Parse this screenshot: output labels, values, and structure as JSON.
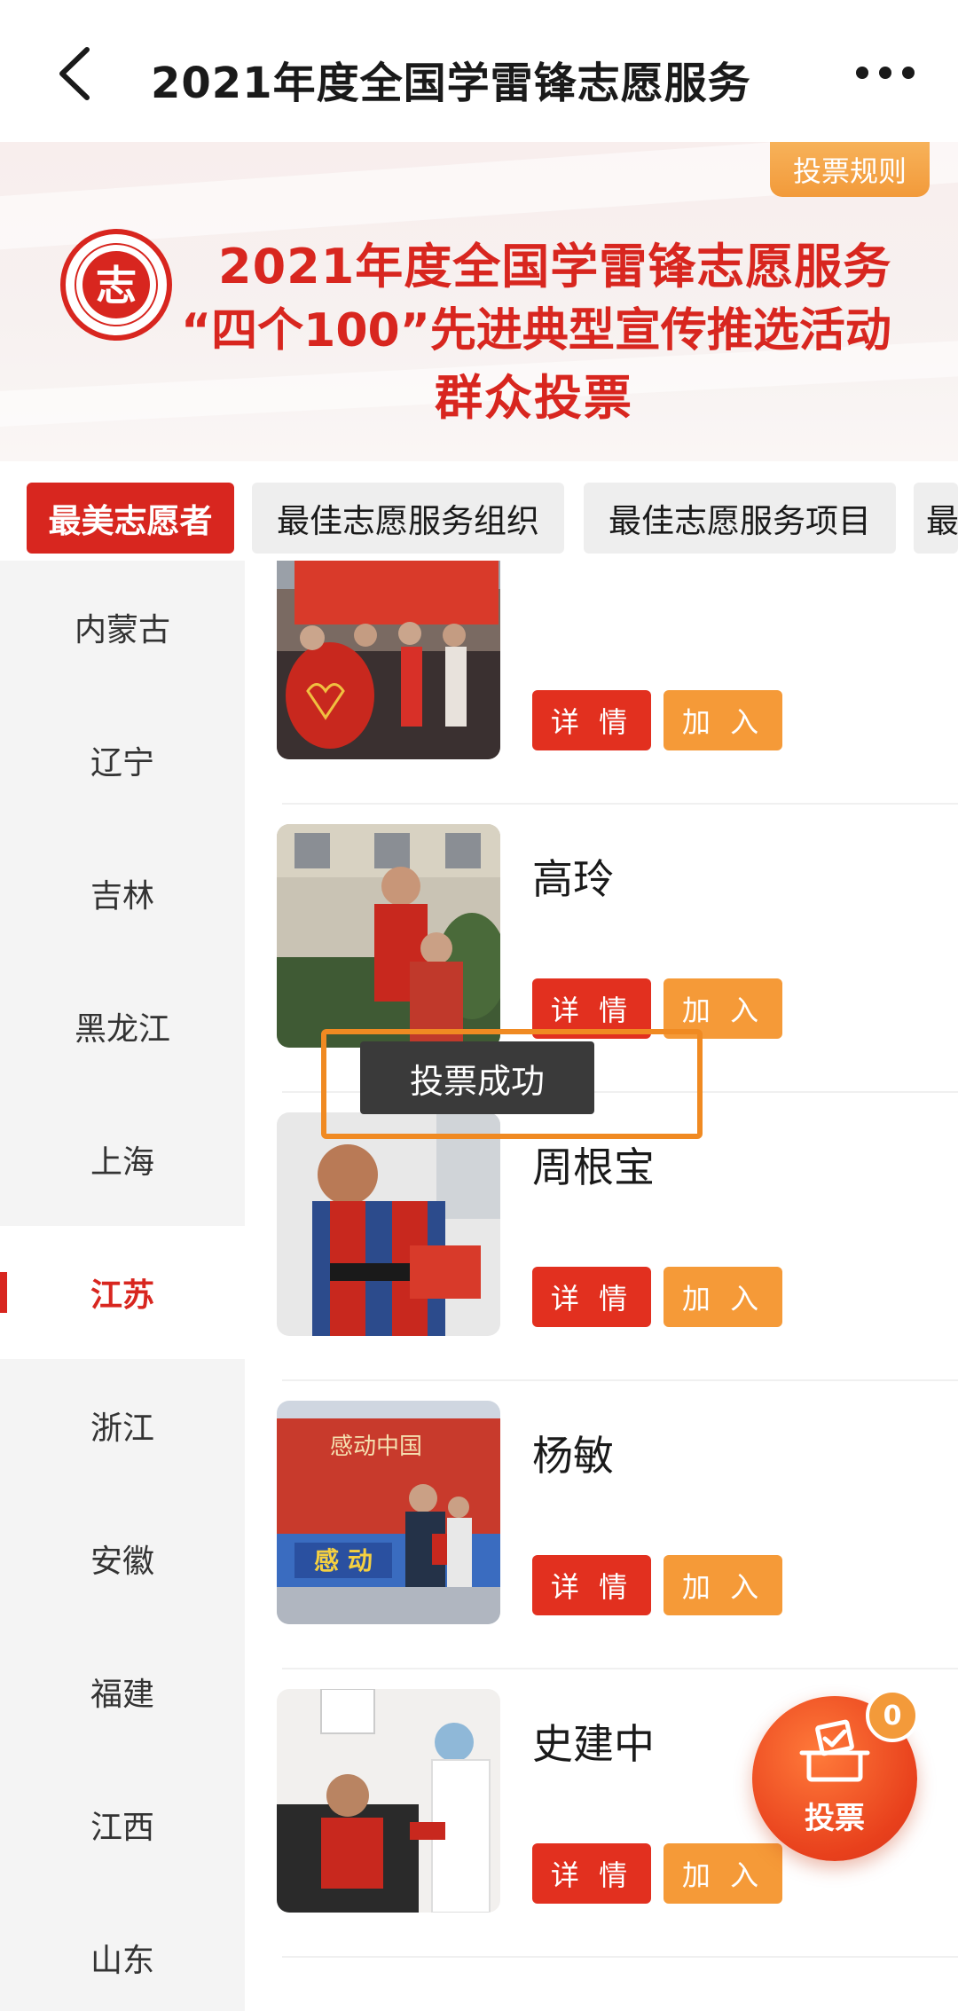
{
  "header": {
    "title": "2021年度全国学雷锋志愿服务",
    "back_icon": "chevron-left-icon",
    "more_icon": "more-horizontal-icon"
  },
  "banner": {
    "rules_label": "投票规则",
    "line1": "2021年度全国学雷锋志愿服务",
    "line2": "“四个100”先进典型宣传推选活动",
    "line3": "群众投票",
    "logo_text": "志",
    "accent": "#d8261f"
  },
  "tabs": [
    {
      "label": "最美志愿者",
      "active": true
    },
    {
      "label": "最佳志愿服务组织",
      "active": false
    },
    {
      "label": "最佳志愿服务项目",
      "active": false
    },
    {
      "label": "最",
      "active": false
    }
  ],
  "sidebar": {
    "items": [
      {
        "label": "内蒙古"
      },
      {
        "label": "辽宁"
      },
      {
        "label": "吉林"
      },
      {
        "label": "黑龙江"
      },
      {
        "label": "上海"
      },
      {
        "label": "江苏",
        "active": true
      },
      {
        "label": "浙江"
      },
      {
        "label": "安徽"
      },
      {
        "label": "福建"
      },
      {
        "label": "江西"
      },
      {
        "label": "山东"
      }
    ]
  },
  "list": {
    "detail_label": "详 情",
    "join_label": "加 入",
    "items": [
      {
        "name": ""
      },
      {
        "name": "高玲"
      },
      {
        "name": "周根宝"
      },
      {
        "name": "杨敏"
      },
      {
        "name": "史建中"
      }
    ]
  },
  "toast": {
    "text": "投票成功"
  },
  "fab": {
    "label": "投票",
    "count": "0",
    "icon": "ballot-box-icon"
  }
}
